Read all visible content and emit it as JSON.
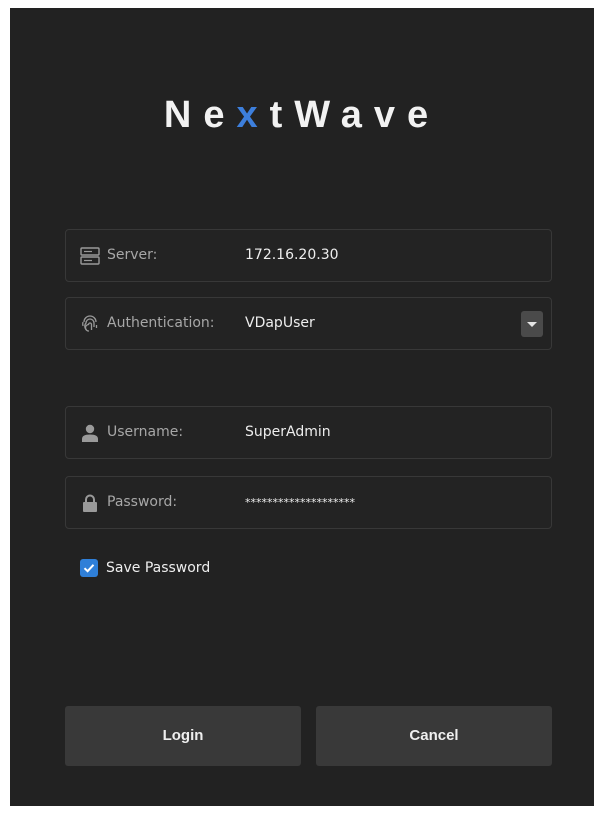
{
  "app": {
    "logo_parts": [
      "Ne",
      "x",
      "tWave"
    ],
    "accent_color": "#3d7fdc"
  },
  "fields": {
    "server": {
      "icon": "server-icon",
      "label": "Server:",
      "value": "172.16.20.30"
    },
    "authentication": {
      "icon": "fingerprint-icon",
      "label": "Authentication:",
      "value": "VDapUser",
      "dropdown_icon": "chevron-down-icon"
    },
    "username": {
      "icon": "user-icon",
      "label": "Username:",
      "value": "SuperAdmin"
    },
    "password": {
      "icon": "lock-icon",
      "label": "Password:",
      "value": "********************"
    }
  },
  "save_password": {
    "label": "Save Password",
    "checked": true
  },
  "buttons": {
    "login": "Login",
    "cancel": "Cancel"
  }
}
